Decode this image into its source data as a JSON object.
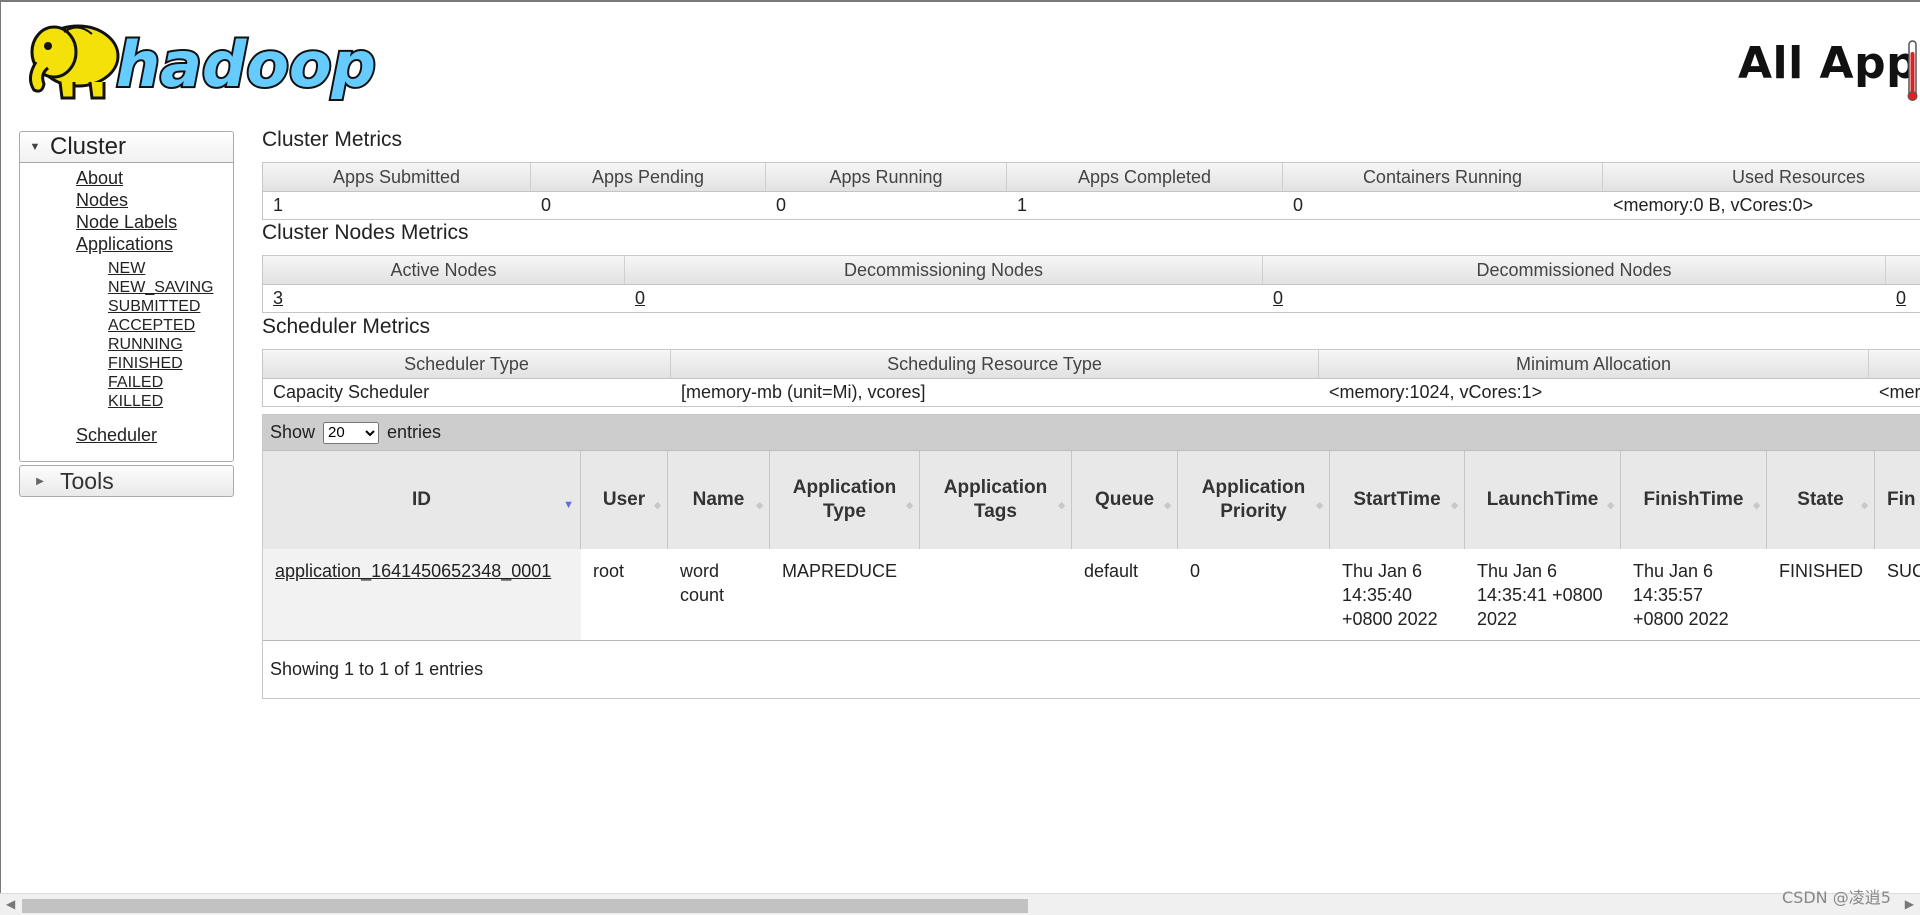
{
  "header": {
    "logo_text": "hadoop",
    "page_title": "All Appli"
  },
  "sidebar": {
    "cluster_label": "Cluster",
    "cluster_links": [
      "About",
      "Nodes",
      "Node Labels",
      "Applications"
    ],
    "app_states": [
      "NEW",
      "NEW_SAVING",
      "SUBMITTED",
      "ACCEPTED",
      "RUNNING",
      "FINISHED",
      "FAILED",
      "KILLED"
    ],
    "scheduler_link": "Scheduler",
    "tools_label": "Tools"
  },
  "cluster_metrics": {
    "title": "Cluster Metrics",
    "headers": [
      "Apps Submitted",
      "Apps Pending",
      "Apps Running",
      "Apps Completed",
      "Containers Running",
      "Used Resources"
    ],
    "values": [
      "1",
      "0",
      "0",
      "1",
      "0",
      "<memory:0 B, vCores:0>"
    ]
  },
  "node_metrics": {
    "title": "Cluster Nodes Metrics",
    "headers": [
      "Active Nodes",
      "Decommissioning Nodes",
      "Decommissioned Nodes"
    ],
    "values": [
      "3",
      "0",
      "0",
      "0"
    ]
  },
  "scheduler_metrics": {
    "title": "Scheduler Metrics",
    "headers": [
      "Scheduler Type",
      "Scheduling Resource Type",
      "Minimum Allocation"
    ],
    "values": [
      "Capacity Scheduler",
      "[memory-mb (unit=Mi), vcores]",
      "<memory:1024, vCores:1>",
      "<mer"
    ]
  },
  "apps_table": {
    "show_label": "Show",
    "entries_label": "entries",
    "page_size": "20",
    "columns": [
      "ID",
      "User",
      "Name",
      "Application Type",
      "Application Tags",
      "Queue",
      "Application Priority",
      "StartTime",
      "LaunchTime",
      "FinishTime",
      "State",
      "Fin"
    ],
    "rows": [
      {
        "id": "application_1641450652348_0001",
        "user": "root",
        "name": "word count",
        "type": "MAPREDUCE",
        "tags": "",
        "queue": "default",
        "priority": "0",
        "start": "Thu Jan 6 14:35:40 +0800 2022",
        "launch": "Thu Jan 6 14:35:41 +0800 2022",
        "finish": "Thu Jan 6 14:35:57 +0800 2022",
        "state": "FINISHED",
        "final_status": "SUC"
      }
    ],
    "info": "Showing 1 to 1 of 1 entries"
  },
  "watermark": "CSDN @凌逍5",
  "colors": {
    "logo_yellow": "#f5e10a",
    "logo_blue": "#66ccff",
    "sort_active": "#5b6fe0"
  }
}
